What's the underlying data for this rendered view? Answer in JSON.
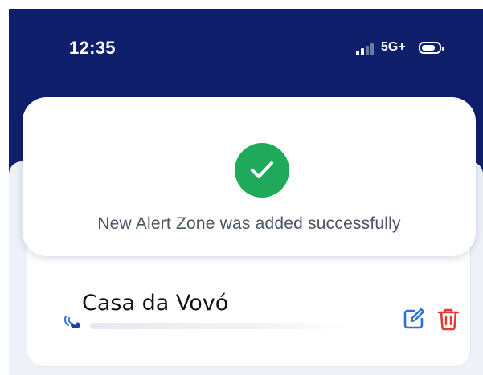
{
  "status_bar": {
    "time": "12:35",
    "network": "5G+",
    "signal_bars_filled": 2,
    "signal_bars_total": 4
  },
  "toast": {
    "message": "New Alert Zone was added successfully",
    "icon": "check-circle-icon",
    "icon_color": "#1eaa5a"
  },
  "zone_card": {
    "name": "Casa da Vovó",
    "edit_icon": "edit-icon",
    "delete_icon": "trash-icon",
    "edit_color": "#2f6fd9",
    "delete_color": "#e53935"
  },
  "colors": {
    "header_background": "#0f1f6b",
    "panel_background": "#eef2f8"
  }
}
